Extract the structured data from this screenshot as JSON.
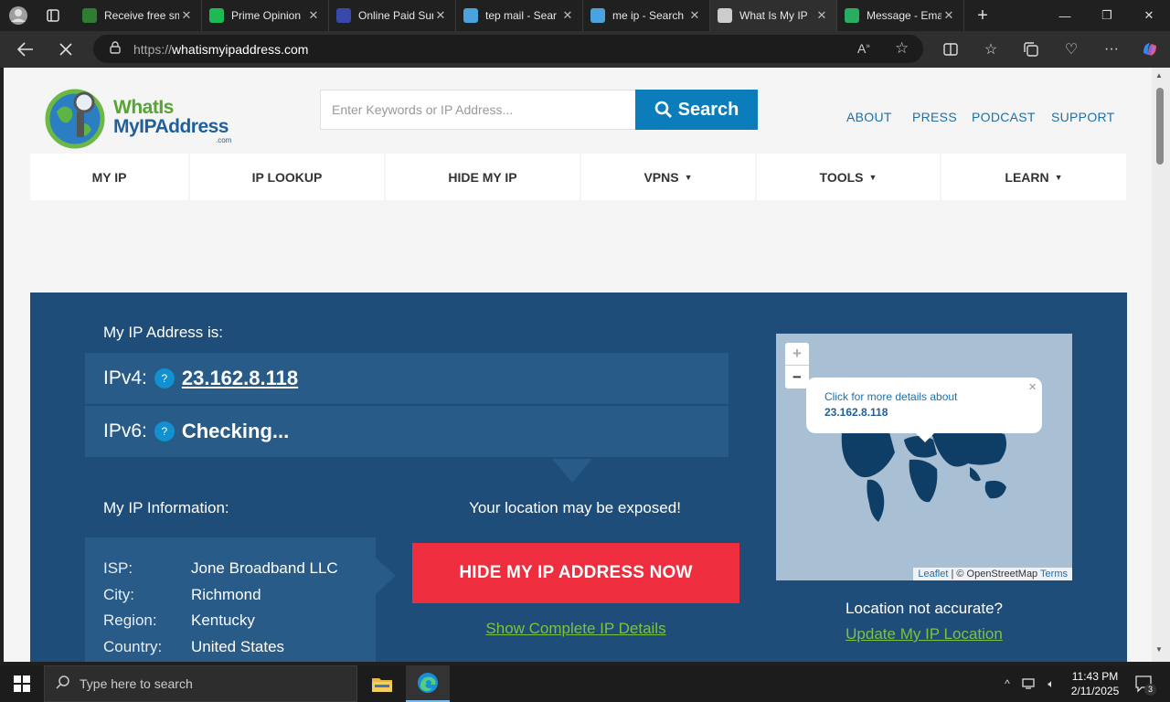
{
  "browser": {
    "tabs": [
      {
        "title": "Receive free sms",
        "icon": "sms-icon",
        "color": "#2e7d32"
      },
      {
        "title": "Prime Opinion",
        "icon": "star-icon",
        "color": "#1db954"
      },
      {
        "title": "Online Paid Sur",
        "icon": "survey-icon",
        "color": "#3949ab"
      },
      {
        "title": "tep mail - Sear",
        "icon": "search-icon",
        "color": "#4aa3df"
      },
      {
        "title": "me ip - Search",
        "icon": "search-icon",
        "color": "#4aa3df"
      },
      {
        "title": "What Is My IP",
        "icon": "loading-icon",
        "color": "#cccccc",
        "active": true
      },
      {
        "title": "Message - Ema",
        "icon": "e-icon",
        "color": "#27ae60"
      }
    ],
    "url_scheme": "https://",
    "url_host": "whatismyipaddress.com"
  },
  "site": {
    "logo": {
      "line1": "WhatIs",
      "line2": "MyIPAddress",
      "line3": ".com"
    },
    "search_placeholder": "Enter Keywords or IP Address...",
    "search_button": "Search",
    "top_links": [
      "ABOUT",
      "PRESS",
      "PODCAST",
      "SUPPORT"
    ],
    "nav": [
      {
        "label": "MY IP",
        "caret": ""
      },
      {
        "label": "IP LOOKUP",
        "caret": ""
      },
      {
        "label": "HIDE MY IP",
        "caret": ""
      },
      {
        "label": "VPNS",
        "caret": "▼"
      },
      {
        "label": "TOOLS",
        "caret": "▼"
      },
      {
        "label": "LEARN",
        "caret": "▼"
      }
    ]
  },
  "hero": {
    "ip_heading": "My IP Address is:",
    "ipv4_label": "IPv4:",
    "ipv4_value": "23.162.8.118",
    "ipv6_label": "IPv6:",
    "ipv6_value": "Checking...",
    "help": "?",
    "info_heading": "My IP Information:",
    "info": [
      {
        "k": "ISP:",
        "v": "Jone Broadband LLC"
      },
      {
        "k": "City:",
        "v": "Richmond"
      },
      {
        "k": "Region:",
        "v": "Kentucky"
      },
      {
        "k": "Country:",
        "v": "United States"
      }
    ],
    "exposed": "Your location may be exposed!",
    "hide_button": "HIDE MY IP ADDRESS NOW",
    "details_link": "Show Complete IP Details",
    "map": {
      "zoom_in": "+",
      "zoom_out": "−",
      "popup_line1": "Click for more details about",
      "popup_line2": "23.162.8.118",
      "popup_close": "×",
      "attrib_leaflet": "Leaflet",
      "attrib_sep": " | © OpenStreetMap ",
      "attrib_terms": "Terms"
    },
    "loc_question": "Location not accurate?",
    "loc_link": "Update My IP Location"
  },
  "taskbar": {
    "search_placeholder": "Type here to search",
    "time": "11:43 PM",
    "date": "2/11/2025",
    "notif_count": "3"
  }
}
